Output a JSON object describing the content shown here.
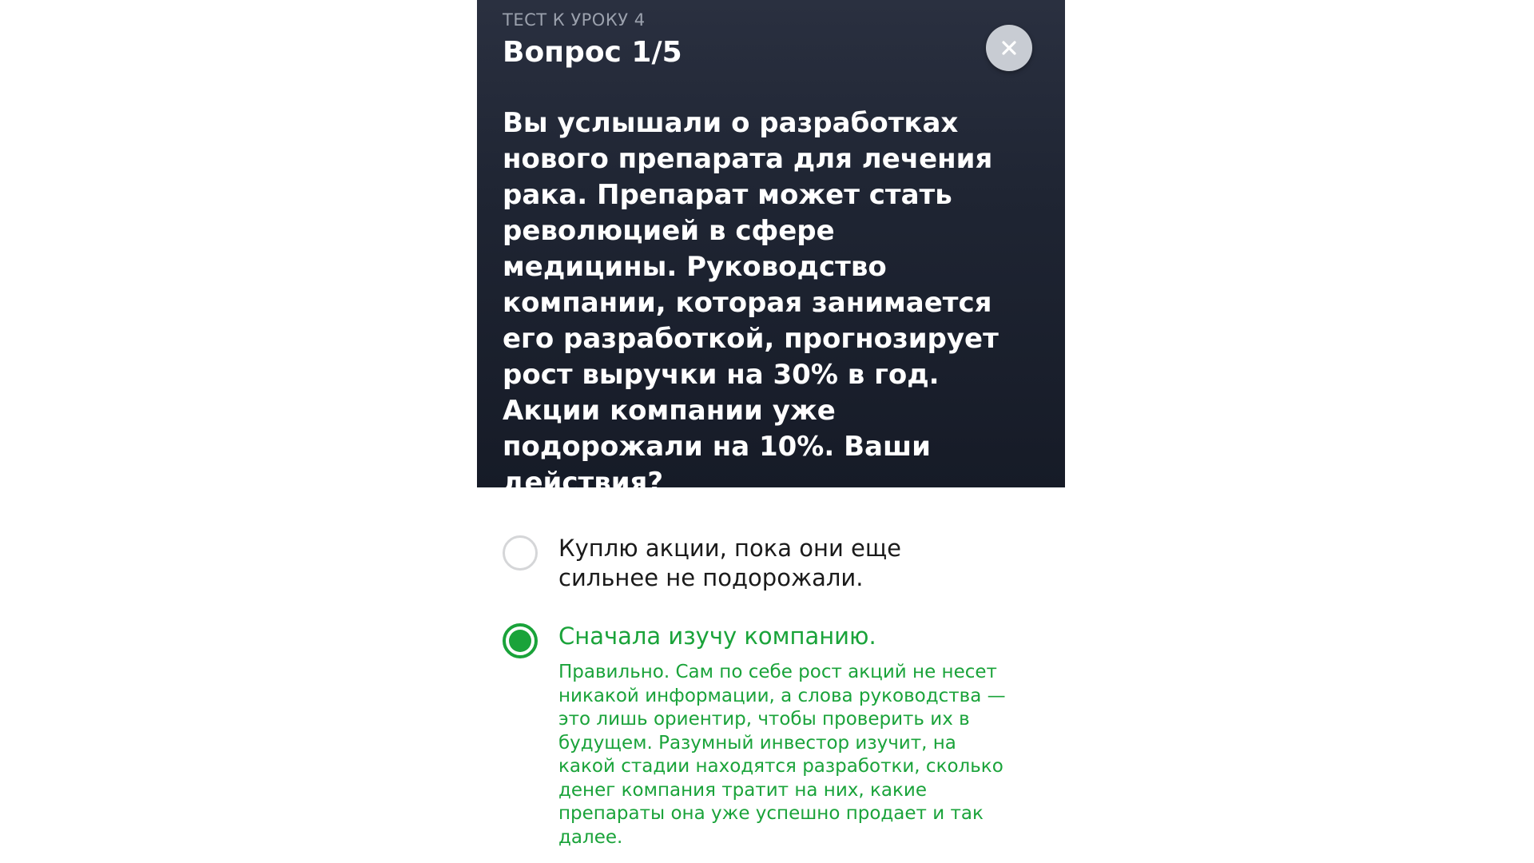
{
  "quiz": {
    "subtitle": "ТЕСТ К УРОКУ 4",
    "counter": "Вопрос 1/5",
    "question": "Вы услышали о разработках нового препарата для лечения рака. Препарат может стать революцией в сфере медицины. Руководство компании, которая занимается его разработкой, прогнозирует рост выручки на 30% в год. Акции компании уже подорожали на 10%. Ваши действия?",
    "close_icon": "close-icon"
  },
  "options": [
    {
      "label": "Куплю акции, пока они еще сильнее не подорожали.",
      "selected": false
    },
    {
      "label": "Сначала изучу компанию.",
      "selected": true,
      "feedback": "Правильно. Сам по себе рост акций не несет никакой информации, а слова руководства — это лишь ориентир, чтобы проверить их в будущем. Разумный инвестор изучит, на какой стадии находятся разработки, сколько денег компания тратит на них, какие препараты она уже успешно продает и так далее."
    }
  ],
  "colors": {
    "header_bg": "#1f2533",
    "accent_green": "#1aa33a",
    "subtitle_gray": "#9ba1ad",
    "close_bg": "#c8ccd3"
  }
}
